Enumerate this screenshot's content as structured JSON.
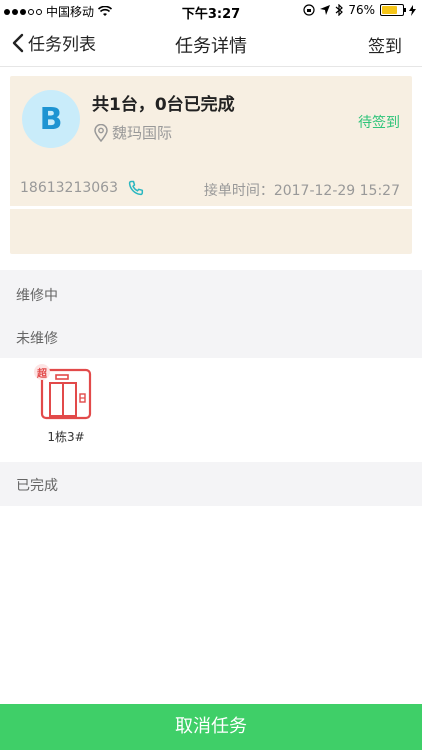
{
  "status_bar": {
    "carrier": "中国移动",
    "time": "下午3:27",
    "battery_pct": "76%",
    "battery_level": 0.76
  },
  "nav": {
    "back_label": "任务列表",
    "title": "任务详情",
    "action_label": "签到"
  },
  "task": {
    "avatar_letter": "B",
    "summary": "共1台，0台已完成",
    "location": "魏玛国际",
    "status": "待签到",
    "phone": "18613213063",
    "order_time": "接单时间：2017-12-29 15:27"
  },
  "sections": {
    "repairing": "维修中",
    "unrepaired": "未维修",
    "completed": "已完成"
  },
  "elevators": [
    {
      "badge": "超",
      "label": "1栋3#"
    }
  ],
  "footer": {
    "cancel_label": "取消任务"
  },
  "colors": {
    "accent_green": "#3fcf68",
    "status_green": "#2fc47a",
    "card_bg": "#f7efe2",
    "elevator_red": "#e24a4a"
  }
}
